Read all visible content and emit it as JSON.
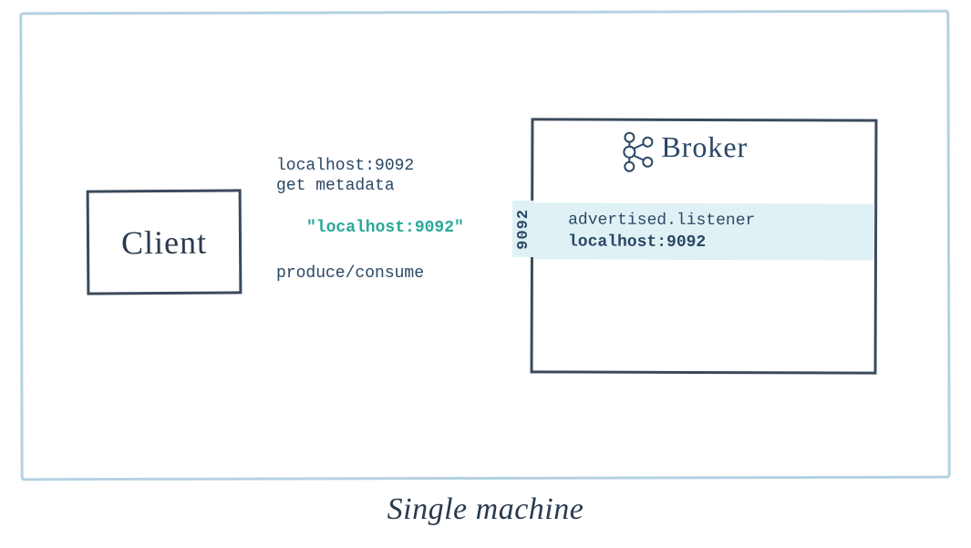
{
  "caption": "Single machine",
  "client": {
    "label": "Client"
  },
  "broker": {
    "label": "Broker",
    "port": "9092",
    "listener_key": "advertised.listener",
    "listener_value": "localhost:9092"
  },
  "arrows": {
    "top_line1": "localhost:9092",
    "top_line2": "get metadata",
    "response": "\"localhost:9092\"",
    "bottom": "produce/consume"
  },
  "colors": {
    "navy": "#2a4766",
    "teal": "#2aa89a",
    "box_border": "#3a4a5c",
    "outer_border": "#b8d4e3",
    "band": "#dff1f5"
  }
}
